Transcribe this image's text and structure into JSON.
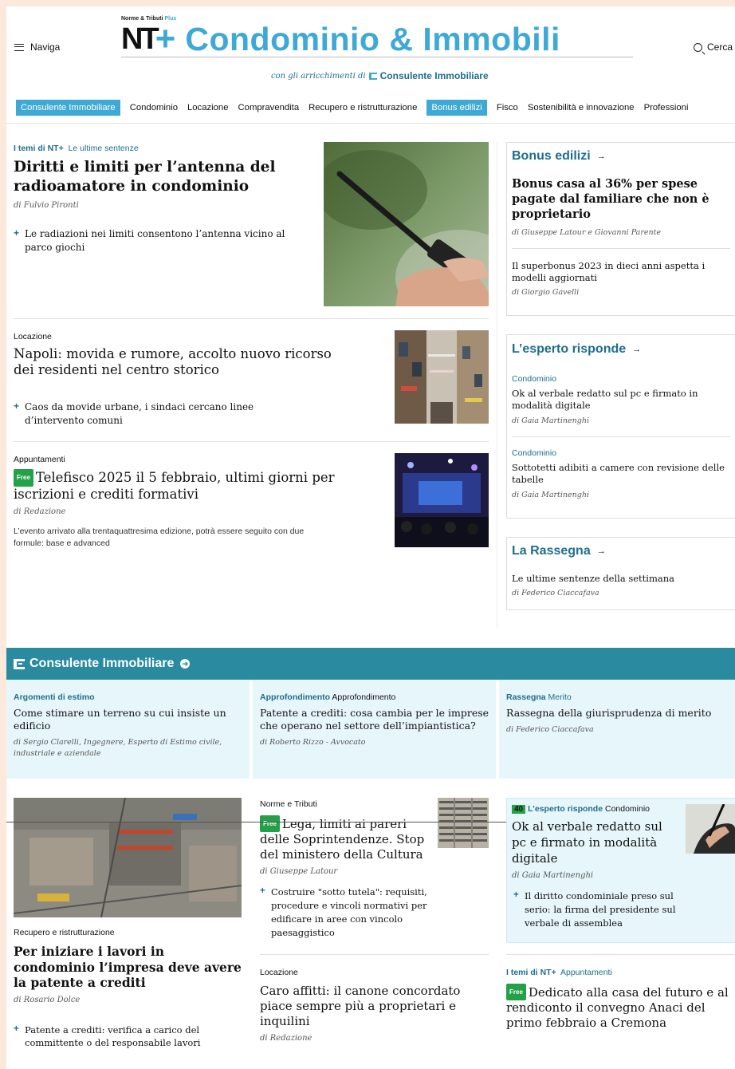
{
  "header": {
    "naviga": "Naviga",
    "brand_sup_1": "Norme & Tributi",
    "brand_sup_2": "Plus",
    "brand_nt": "NT",
    "brand_plus": "+",
    "brand_title": "Condominio & Immobili",
    "brand_sub": "con gli arricchimenti di",
    "brand_sub_name": "Consulente Immobiliare",
    "cerca": "Cerca"
  },
  "nav": [
    {
      "label": "Consulente Immobiliare",
      "highlight": true
    },
    {
      "label": "Condominio",
      "highlight": false
    },
    {
      "label": "Locazione",
      "highlight": false
    },
    {
      "label": "Compravendita",
      "highlight": false
    },
    {
      "label": "Recupero e ristrutturazione",
      "highlight": false
    },
    {
      "label": "Bonus edilizi",
      "highlight": true
    },
    {
      "label": "Fisco",
      "highlight": false
    },
    {
      "label": "Sostenibilità e innovazione",
      "highlight": false
    },
    {
      "label": "Professioni",
      "highlight": false
    }
  ],
  "main": {
    "a1": {
      "kicker_bold": "I temi di NT+",
      "kicker_link": "Le ultime sentenze",
      "title": "Diritti e limiti per l’antenna del radioamatore in condominio",
      "author": "di Fulvio Pironti",
      "bullet": "Le radiazioni nei limiti consentono l’antenna vicino al parco giochi"
    },
    "a2": {
      "kicker": "Locazione",
      "title": "Napoli: movida e rumore, accolto nuovo ricorso dei residenti nel centro storico",
      "bullet": "Caos da movide urbane, i sindaci cercano linee d’intervento comuni"
    },
    "a3": {
      "kicker": "Appuntamenti",
      "free": "Free",
      "title": "Telefisco 2025 il 5 febbraio, ultimi giorni per iscrizioni e crediti formativi",
      "author": "di Redazione",
      "summary": "L’evento arrivato alla trentaquattresima edizione, potrà essere seguito con due formule: base e advanced"
    }
  },
  "sidebar": {
    "bonus": {
      "heading": "Bonus edilizi",
      "lead_title": "Bonus casa al 36% per spese pagate dal familiare che non è proprietario",
      "lead_author": "di Giuseppe Latour e Giovanni Parente",
      "item_title": "Il superbonus 2023 in dieci anni aspetta i modelli aggiornati",
      "item_author": "di Giorgio Gavelli"
    },
    "esperto": {
      "heading": "L’esperto risponde",
      "items": [
        {
          "kicker": "Condominio",
          "title": "Ok al verbale redatto sul pc e firmato in modalità digitale",
          "author": "di Gaia Martinenghi"
        },
        {
          "kicker": "Condominio",
          "title": "Sottotetti adibiti a camere con revisione delle tabelle",
          "author": "di Gaia Martinenghi"
        }
      ]
    },
    "rassegna": {
      "heading": "La Rassegna",
      "title": "Le ultime sentenze della settimana",
      "author": "di Federico Ciaccafava"
    }
  },
  "consulente": {
    "heading": "Consulente Immobiliare",
    "cols": [
      {
        "kicker_bold": "Argomenti di estimo",
        "kicker": "",
        "title": "Come stimare un terreno su cui insiste un edificio",
        "author": "di Sergio Clarelli, Ingegnere, Esperto di Estimo civile, industriale e aziendale"
      },
      {
        "kicker_bold": "Approfondimento",
        "kicker": "Approfondimento",
        "title": "Patente a crediti: cosa cambia per le imprese che operano nel settore dell’impiantistica?",
        "author": "di Roberto Rizzo - Avvocato"
      },
      {
        "kicker_bold": "Rassegna",
        "kicker": "Merito",
        "title": "Rassegna della giurisprudenza di merito",
        "author": "di Federico Ciaccafava"
      }
    ]
  },
  "lower": {
    "left": {
      "kicker": "Recupero e ristrutturazione",
      "title": "Per iniziare i lavori in condominio l’impresa deve avere la patente a crediti",
      "author": "di Rosario Dolce",
      "bullet": "Patente a crediti: verifica a carico del committente o del responsabile lavori"
    },
    "mid1": {
      "kicker": "Norme e Tributi",
      "free": "Free",
      "title": "Lega, limiti ai pareri delle Soprintendenze. Stop del ministero della Cultura",
      "author": "di Giuseppe Latour",
      "bullet": "Costruire \"sotto tutela\": requisiti, procedure e vincoli normativi per edificare in aree con vincolo paesaggistico"
    },
    "mid2": {
      "kicker": "Locazione",
      "title": "Caro affitti: il canone concordato piace sempre più a proprietari e inquilini",
      "author": "di Redazione"
    },
    "right1": {
      "tag": "40",
      "kicker_bold": "L’esperto risponde",
      "kicker": "Condominio",
      "title": "Ok al verbale redatto sul pc e firmato in modalità digitale",
      "author": "di Gaia Martinenghi",
      "bullet": "Il diritto condominiale preso sul serio: la firma del presidente sul verbale di assemblea"
    },
    "right2": {
      "kicker_bold": "I temi di NT+",
      "kicker": "Appuntamenti",
      "free": "Free",
      "title": "Dedicato alla casa del futuro e al rendiconto il convegno Anaci del primo febbraio a Cremona"
    }
  },
  "colors": {
    "accent": "#3fa9d6",
    "teal_band": "#2a8aa0",
    "link": "#1f6d8c",
    "free": "#24a148",
    "light_blue": "#e7f6fb"
  }
}
